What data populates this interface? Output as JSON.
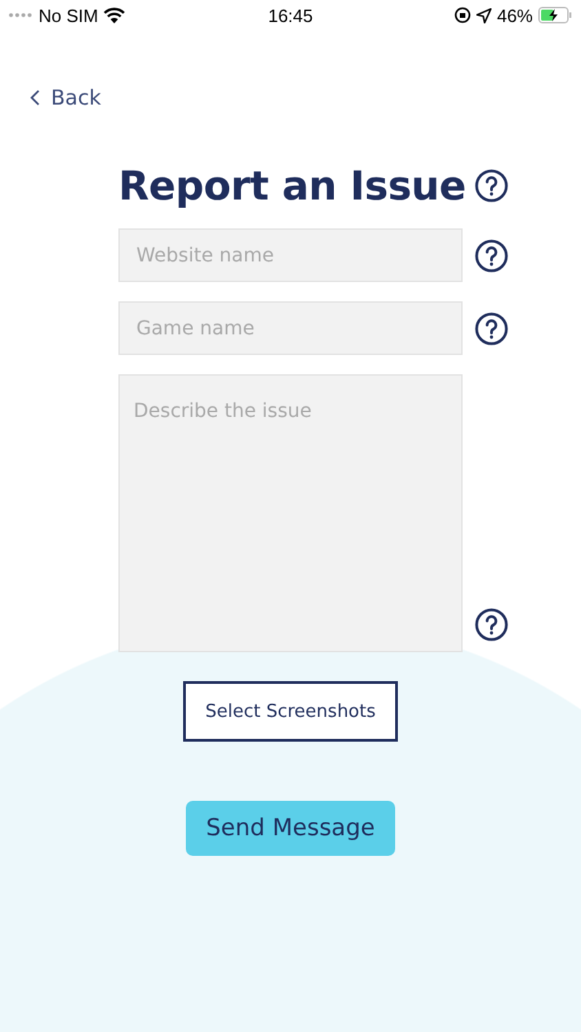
{
  "status_bar": {
    "carrier": "No SIM",
    "time": "16:45",
    "battery": "46%"
  },
  "back": {
    "label": "Back"
  },
  "title": "Report an Issue",
  "fields": [
    {
      "kind": "input",
      "placeholder": "Website name"
    },
    {
      "kind": "input",
      "placeholder": "Game name"
    },
    {
      "kind": "textarea",
      "placeholder": "Describe the issue"
    }
  ],
  "buttons": [
    {
      "kind": "outline",
      "label": "Select Screenshots"
    },
    {
      "kind": "filled",
      "label": "Send Message"
    }
  ]
}
